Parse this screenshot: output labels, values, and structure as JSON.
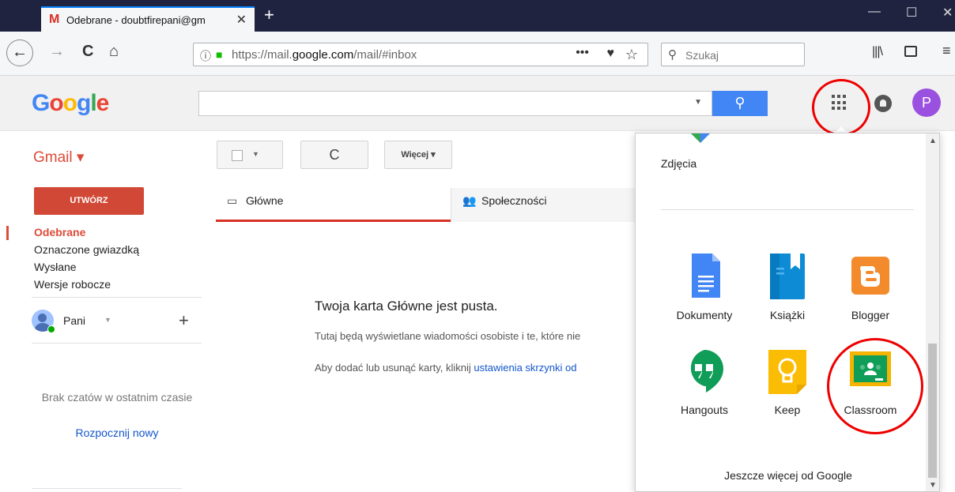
{
  "browser": {
    "tab_title": "Odebrane - doubtfirepani@gm",
    "tab_favicon": "M",
    "new_tab": "+",
    "url_prefix": "https://mail.",
    "url_host": "google.com",
    "url_path": "/mail/#inbox",
    "search_placeholder": "Szukaj"
  },
  "gmail": {
    "logo": "Google",
    "product_label": "Gmail ▾",
    "toolbar": {
      "more_label": "Więcej ▾",
      "refresh_icon": "C"
    },
    "compose_label": "UTWÓRZ",
    "nav": [
      {
        "label": "Odebrane",
        "active": true
      },
      {
        "label": "Oznaczone gwiazdką"
      },
      {
        "label": "Wysłane"
      },
      {
        "label": "Wersje robocze"
      }
    ],
    "account_name": "Pani",
    "chat_empty": "Brak czatów w ostatnim czasie",
    "chat_start": "Rozpocznij nowy",
    "avatar_letter": "P",
    "tabs": [
      {
        "label": "Główne",
        "icon": "inbox-icon"
      },
      {
        "label": "Społeczności",
        "icon": "people-icon"
      }
    ],
    "empty": {
      "title": "Twoja karta Główne jest pusta.",
      "line1": "Tutaj będą wyświetlane wiadomości osobiste i te, które nie",
      "line2_text": "Aby dodać lub usunąć karty, kliknij ",
      "line2_link": "ustawienia skrzynki od"
    }
  },
  "apps_popup": {
    "top_app": "Zdjęcia",
    "apps": [
      {
        "label": "Dokumenty",
        "icon": "docs-icon"
      },
      {
        "label": "Książki",
        "icon": "books-icon"
      },
      {
        "label": "Blogger",
        "icon": "blogger-icon"
      },
      {
        "label": "Hangouts",
        "icon": "hangouts-icon"
      },
      {
        "label": "Keep",
        "icon": "keep-icon"
      },
      {
        "label": "Classroom",
        "icon": "classroom-icon"
      }
    ],
    "more_label": "Jeszcze więcej od Google"
  },
  "colors": {
    "gmail_red": "#dd4b39",
    "google_blue": "#4285f4",
    "annotation_red": "#e00000",
    "link_blue": "#1155cc"
  }
}
